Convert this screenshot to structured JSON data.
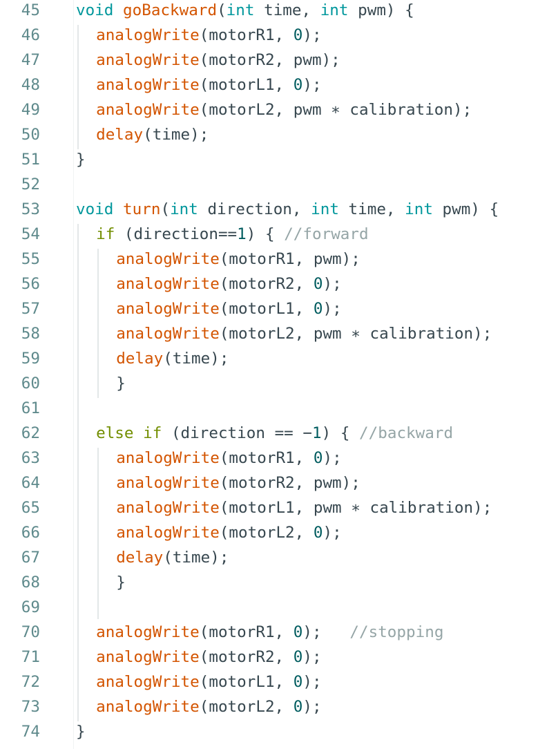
{
  "editor": {
    "lines": [
      {
        "num": "45",
        "indent": 0,
        "tokens": [
          {
            "t": "kw",
            "v": "void"
          },
          {
            "t": "p",
            "v": " "
          },
          {
            "t": "fn",
            "v": "goBackward"
          },
          {
            "t": "p",
            "v": "("
          },
          {
            "t": "kw",
            "v": "int"
          },
          {
            "t": "p",
            "v": " time, "
          },
          {
            "t": "kw",
            "v": "int"
          },
          {
            "t": "p",
            "v": " pwm) {"
          }
        ]
      },
      {
        "num": "46",
        "indent": 1,
        "tokens": [
          {
            "t": "fn",
            "v": "analogWrite"
          },
          {
            "t": "p",
            "v": "(motorR1, "
          },
          {
            "t": "num",
            "v": "0"
          },
          {
            "t": "p",
            "v": ");"
          }
        ]
      },
      {
        "num": "47",
        "indent": 1,
        "tokens": [
          {
            "t": "fn",
            "v": "analogWrite"
          },
          {
            "t": "p",
            "v": "(motorR2, pwm);"
          }
        ]
      },
      {
        "num": "48",
        "indent": 1,
        "tokens": [
          {
            "t": "fn",
            "v": "analogWrite"
          },
          {
            "t": "p",
            "v": "(motorL1, "
          },
          {
            "t": "num",
            "v": "0"
          },
          {
            "t": "p",
            "v": ");"
          }
        ]
      },
      {
        "num": "49",
        "indent": 1,
        "tokens": [
          {
            "t": "fn",
            "v": "analogWrite"
          },
          {
            "t": "p",
            "v": "(motorL2, pwm ∗ calibration);"
          }
        ]
      },
      {
        "num": "50",
        "indent": 1,
        "tokens": [
          {
            "t": "fn",
            "v": "delay"
          },
          {
            "t": "p",
            "v": "(time);"
          }
        ]
      },
      {
        "num": "51",
        "indent": 0,
        "tokens": [
          {
            "t": "p",
            "v": "}"
          }
        ]
      },
      {
        "num": "52",
        "indent": 0,
        "tokens": []
      },
      {
        "num": "53",
        "indent": 0,
        "tokens": [
          {
            "t": "kw",
            "v": "void"
          },
          {
            "t": "p",
            "v": " "
          },
          {
            "t": "fn",
            "v": "turn"
          },
          {
            "t": "p",
            "v": "("
          },
          {
            "t": "kw",
            "v": "int"
          },
          {
            "t": "p",
            "v": " direction, "
          },
          {
            "t": "kw",
            "v": "int"
          },
          {
            "t": "p",
            "v": " time, "
          },
          {
            "t": "kw",
            "v": "int"
          },
          {
            "t": "p",
            "v": " pwm) {"
          }
        ]
      },
      {
        "num": "54",
        "indent": 1,
        "tokens": [
          {
            "t": "ctl",
            "v": "if"
          },
          {
            "t": "p",
            "v": " (direction=="
          },
          {
            "t": "num",
            "v": "1"
          },
          {
            "t": "p",
            "v": ") { "
          },
          {
            "t": "cm",
            "v": "//forward"
          }
        ]
      },
      {
        "num": "55",
        "indent": 2,
        "tokens": [
          {
            "t": "fn",
            "v": "analogWrite"
          },
          {
            "t": "p",
            "v": "(motorR1, pwm);"
          }
        ]
      },
      {
        "num": "56",
        "indent": 2,
        "tokens": [
          {
            "t": "fn",
            "v": "analogWrite"
          },
          {
            "t": "p",
            "v": "(motorR2, "
          },
          {
            "t": "num",
            "v": "0"
          },
          {
            "t": "p",
            "v": ");"
          }
        ]
      },
      {
        "num": "57",
        "indent": 2,
        "tokens": [
          {
            "t": "fn",
            "v": "analogWrite"
          },
          {
            "t": "p",
            "v": "(motorL1, "
          },
          {
            "t": "num",
            "v": "0"
          },
          {
            "t": "p",
            "v": ");"
          }
        ]
      },
      {
        "num": "58",
        "indent": 2,
        "tokens": [
          {
            "t": "fn",
            "v": "analogWrite"
          },
          {
            "t": "p",
            "v": "(motorL2, pwm ∗ calibration);"
          }
        ]
      },
      {
        "num": "59",
        "indent": 2,
        "tokens": [
          {
            "t": "fn",
            "v": "delay"
          },
          {
            "t": "p",
            "v": "(time);"
          }
        ]
      },
      {
        "num": "60",
        "indent": 2,
        "tokens": [
          {
            "t": "p",
            "v": "}"
          }
        ]
      },
      {
        "num": "61",
        "indent": 0,
        "tokens": []
      },
      {
        "num": "62",
        "indent": 1,
        "tokens": [
          {
            "t": "ctl",
            "v": "else"
          },
          {
            "t": "p",
            "v": " "
          },
          {
            "t": "ctl",
            "v": "if"
          },
          {
            "t": "p",
            "v": " (direction == −"
          },
          {
            "t": "num",
            "v": "1"
          },
          {
            "t": "p",
            "v": ") { "
          },
          {
            "t": "cm",
            "v": "//backward"
          }
        ]
      },
      {
        "num": "63",
        "indent": 2,
        "tokens": [
          {
            "t": "fn",
            "v": "analogWrite"
          },
          {
            "t": "p",
            "v": "(motorR1, "
          },
          {
            "t": "num",
            "v": "0"
          },
          {
            "t": "p",
            "v": ");"
          }
        ]
      },
      {
        "num": "64",
        "indent": 2,
        "tokens": [
          {
            "t": "fn",
            "v": "analogWrite"
          },
          {
            "t": "p",
            "v": "(motorR2, pwm);"
          }
        ]
      },
      {
        "num": "65",
        "indent": 2,
        "tokens": [
          {
            "t": "fn",
            "v": "analogWrite"
          },
          {
            "t": "p",
            "v": "(motorL1, pwm ∗ calibration);"
          }
        ]
      },
      {
        "num": "66",
        "indent": 2,
        "tokens": [
          {
            "t": "fn",
            "v": "analogWrite"
          },
          {
            "t": "p",
            "v": "(motorL2, "
          },
          {
            "t": "num",
            "v": "0"
          },
          {
            "t": "p",
            "v": ");"
          }
        ]
      },
      {
        "num": "67",
        "indent": 2,
        "tokens": [
          {
            "t": "fn",
            "v": "delay"
          },
          {
            "t": "p",
            "v": "(time);"
          }
        ]
      },
      {
        "num": "68",
        "indent": 2,
        "tokens": [
          {
            "t": "p",
            "v": "}"
          }
        ]
      },
      {
        "num": "69",
        "indent": 0,
        "tokens": []
      },
      {
        "num": "70",
        "indent": 1,
        "tokens": [
          {
            "t": "fn",
            "v": "analogWrite"
          },
          {
            "t": "p",
            "v": "(motorR1, "
          },
          {
            "t": "num",
            "v": "0"
          },
          {
            "t": "p",
            "v": ");   "
          },
          {
            "t": "cm",
            "v": "//stopping"
          }
        ]
      },
      {
        "num": "71",
        "indent": 1,
        "tokens": [
          {
            "t": "fn",
            "v": "analogWrite"
          },
          {
            "t": "p",
            "v": "(motorR2, "
          },
          {
            "t": "num",
            "v": "0"
          },
          {
            "t": "p",
            "v": ");"
          }
        ]
      },
      {
        "num": "72",
        "indent": 1,
        "tokens": [
          {
            "t": "fn",
            "v": "analogWrite"
          },
          {
            "t": "p",
            "v": "(motorL1, "
          },
          {
            "t": "num",
            "v": "0"
          },
          {
            "t": "p",
            "v": ");"
          }
        ]
      },
      {
        "num": "73",
        "indent": 1,
        "tokens": [
          {
            "t": "fn",
            "v": "analogWrite"
          },
          {
            "t": "p",
            "v": "(motorL2, "
          },
          {
            "t": "num",
            "v": "0"
          },
          {
            "t": "p",
            "v": ");"
          }
        ]
      },
      {
        "num": "74",
        "indent": 0,
        "tokens": [
          {
            "t": "p",
            "v": "}"
          }
        ]
      }
    ]
  },
  "colors": {
    "keyword": "#00979c",
    "control": "#728e00",
    "function": "#d35400",
    "number": "#005c5f",
    "comment": "#95a5a6",
    "text": "#37474f",
    "line_number": "#5f8a8c"
  }
}
